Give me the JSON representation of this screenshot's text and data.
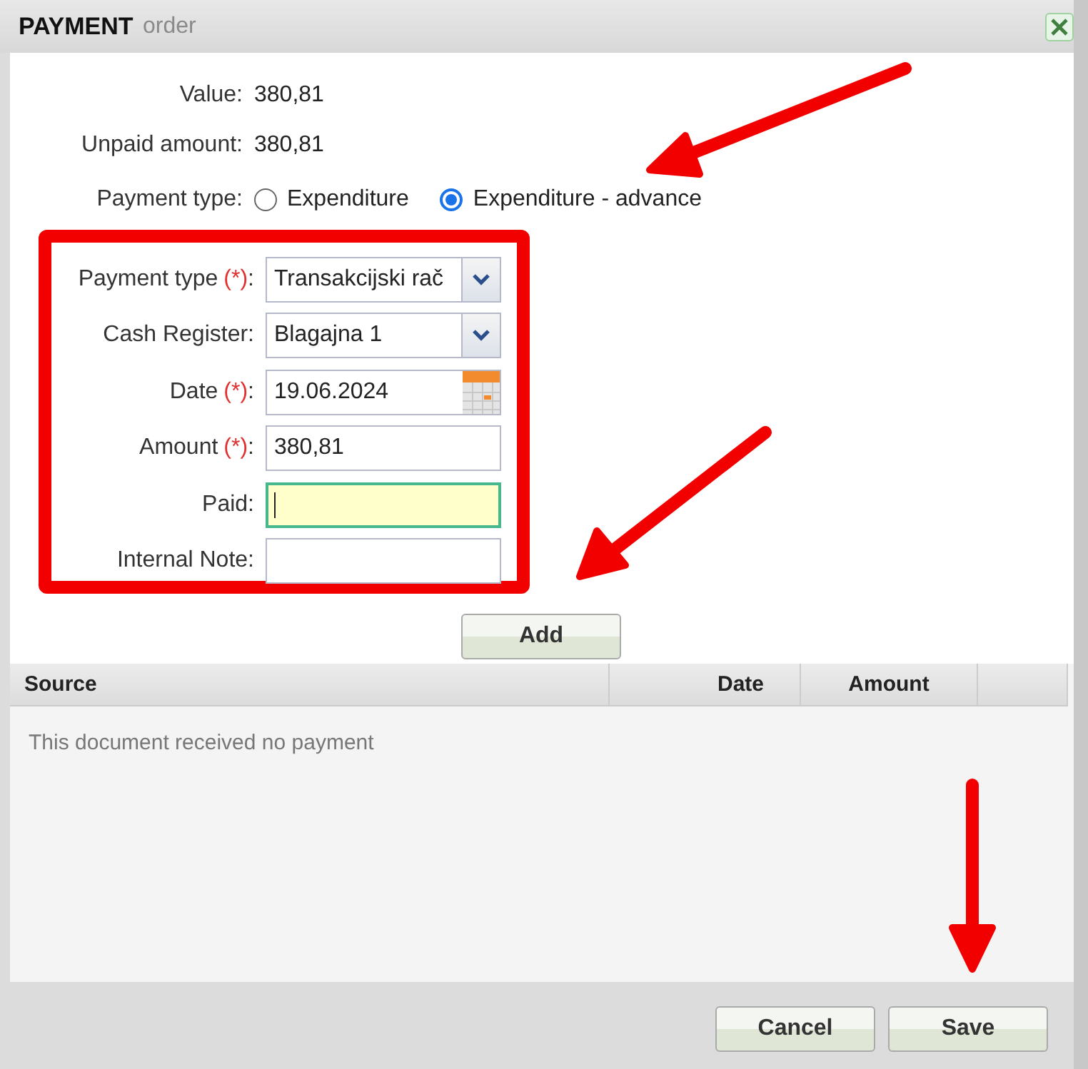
{
  "background_text": "order",
  "window": {
    "title": "PAYMENT"
  },
  "info": [
    {
      "label": "Value:",
      "value": "380,81"
    },
    {
      "label": "Unpaid amount:",
      "value": "380,81"
    }
  ],
  "payment_type": {
    "label": "Payment type:",
    "options": [
      {
        "label": "Expenditure",
        "selected": false
      },
      {
        "label": "Expenditure - advance",
        "selected": true
      }
    ]
  },
  "fields": [
    {
      "kind": "select",
      "label": "Payment type",
      "mark": "(*)",
      "suffix": ":",
      "value": "Transakcijski rač"
    },
    {
      "kind": "select",
      "label": "Cash Register",
      "suffix": ":",
      "value": "Blagajna 1"
    },
    {
      "kind": "date",
      "label": "Date",
      "mark": "(*)",
      "suffix": ":",
      "value": "19.06.2024"
    },
    {
      "kind": "text",
      "label": "Amount",
      "mark": "(*)",
      "suffix": ":",
      "value": "380,81",
      "focused": false
    },
    {
      "kind": "text",
      "label": "Paid",
      "suffix": ":",
      "focused": true
    },
    {
      "kind": "text",
      "label": "Internal Note",
      "suffix": ":",
      "focused": false
    }
  ],
  "add_button": "Add",
  "table": {
    "columns": [
      "Source",
      "Date",
      "Amount"
    ],
    "empty_message": "This document received no payment"
  },
  "buttons": [
    "Cancel",
    "Save"
  ]
}
